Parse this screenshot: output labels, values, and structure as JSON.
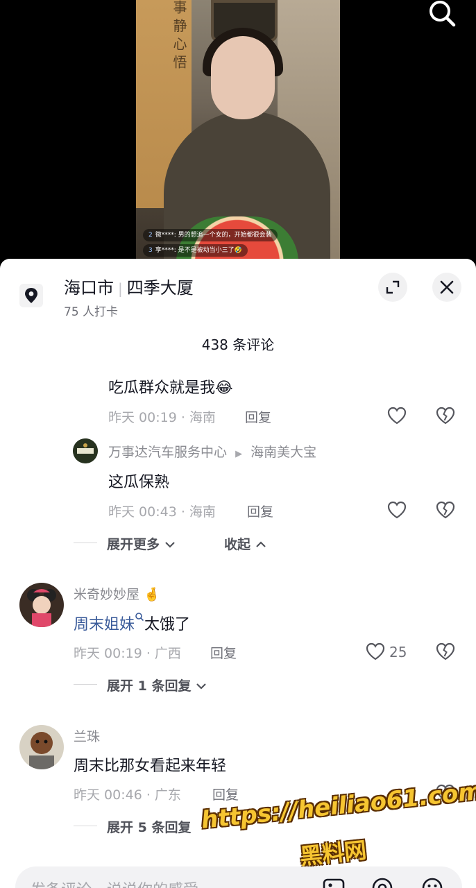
{
  "video": {
    "scroll_text": "事 静 心 悟",
    "danmu": [
      {
        "level": "2",
        "user": "微****:",
        "text": "男的想追一个女的，开始都很会装"
      },
      {
        "level": "3",
        "user": "享****:",
        "text": "是不是被动当小三了🤣"
      }
    ]
  },
  "location": {
    "city": "海口市",
    "place": "四季大厦",
    "checkins": "75 人打卡"
  },
  "comments_header": {
    "count": "438 条评论"
  },
  "comments": {
    "c1": {
      "text": "吃瓜群众就是我😂",
      "meta": "昨天 00:19 · 海南",
      "reply": "回复"
    },
    "c2": {
      "user": "万事达汽车服务中心",
      "arrow": "▶",
      "reply_to": "海南美大宝",
      "text": "这瓜保熟",
      "meta": "昨天 00:43 · 海南",
      "reply": "回复"
    },
    "expand1": {
      "more": "展开更多",
      "collapse": "收起"
    },
    "c3": {
      "user": "米奇妙妙屋",
      "badge": "🤞",
      "mention": "周末姐妹",
      "text": "太饿了",
      "meta": "昨天 00:19 · 广西",
      "reply": "回复",
      "likes": "25"
    },
    "expand2": {
      "text": "展开 1 条回复"
    },
    "c4": {
      "user": "兰珠",
      "text": "周末比那女看起来年轻",
      "meta": "昨天 00:46 · 广东",
      "reply": "回复"
    },
    "expand3": {
      "text": "展开 5 条回复"
    }
  },
  "watermark": {
    "url": "https://heiliao61.com",
    "name": "黑料网"
  },
  "input": {
    "placeholder": "发条评论，说说你的感受"
  }
}
